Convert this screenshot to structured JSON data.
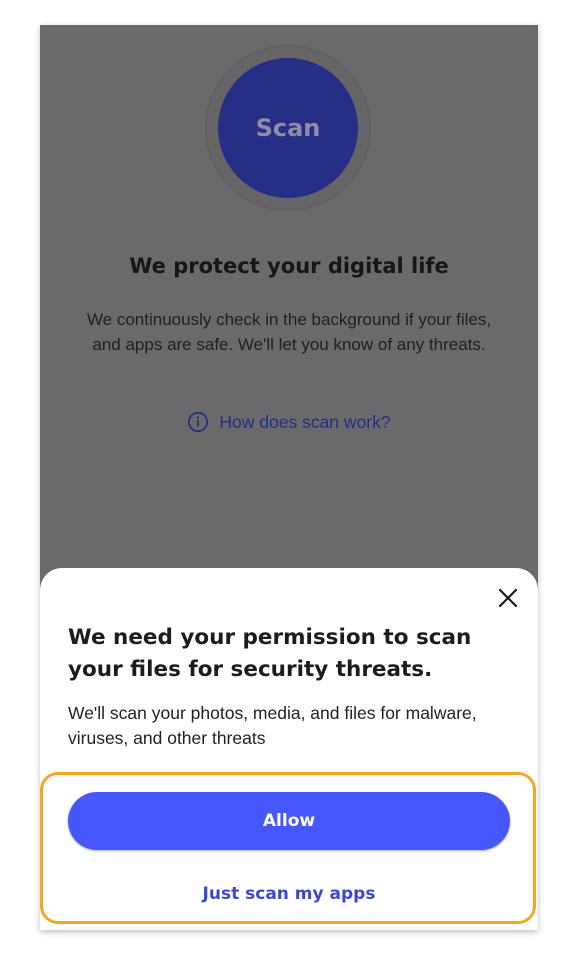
{
  "background": {
    "scan_button_label": "Scan",
    "headline": "We protect your digital life",
    "description": "We continuously check in the background if your files, and apps are safe. We'll let you know of any threats.",
    "help_link": "How does scan work?",
    "help_icon": "info-icon"
  },
  "permission_sheet": {
    "close_icon": "close-icon",
    "title": "We need your permission to scan your files for security threats.",
    "description": "We'll scan your photos, media, and files for malware, viruses, and other threats",
    "allow_label": "Allow",
    "secondary_label": "Just scan my apps"
  },
  "colors": {
    "overlay": "#6a6a6c",
    "scan_button": "#262e85",
    "primary": "#4658fb",
    "link": "#3a47d6",
    "highlight_border": "#f5a623"
  }
}
